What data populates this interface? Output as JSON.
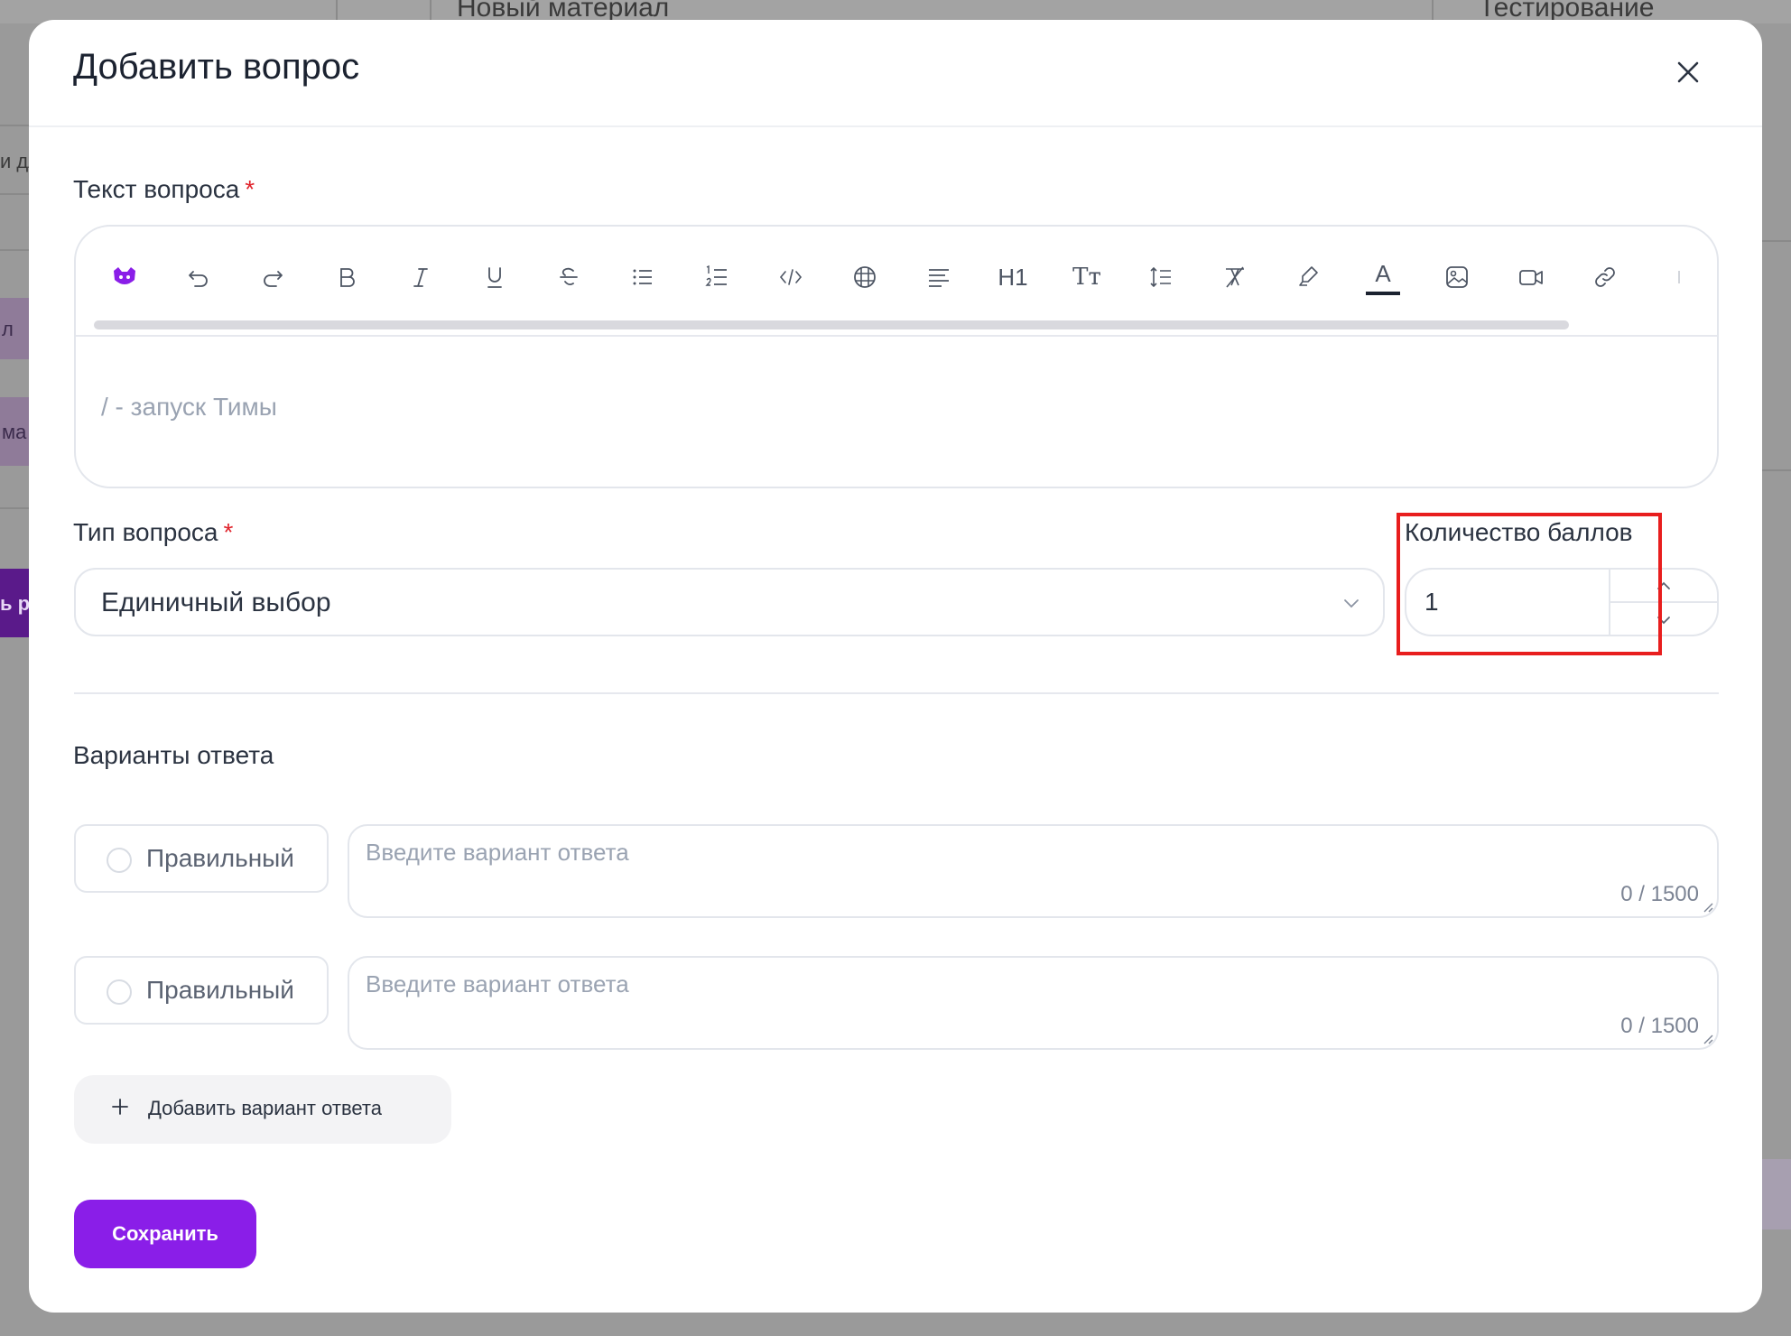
{
  "background": {
    "topbar_left_text": "Новый материал",
    "topbar_right_text": "Тестирование",
    "side_text_1": "и дл",
    "side_chip_1": "л",
    "side_chip_2": "ма",
    "side_chip_3": "ь р"
  },
  "modal": {
    "title": "Добавить вопрос",
    "close_icon": "close-icon"
  },
  "question_text": {
    "label": "Текст вопроса",
    "required_mark": "*",
    "placeholder": "/ - запуск Тимы",
    "toolbar": {
      "heading_label": "H1",
      "text_size_label": "Tт",
      "font_color_label": "A",
      "icons": [
        "tima-icon",
        "undo-icon",
        "redo-icon",
        "bold-icon",
        "italic-icon",
        "underline-icon",
        "strikethrough-icon",
        "bullet-list-icon",
        "numbered-list-icon",
        "code-icon",
        "table-icon",
        "align-icon",
        "heading-icon",
        "text-size-icon",
        "line-height-icon",
        "clear-format-icon",
        "highlighter-icon",
        "font-color-icon",
        "image-icon",
        "video-icon",
        "link-icon"
      ]
    }
  },
  "question_type": {
    "label": "Тип вопроса",
    "required_mark": "*",
    "value": "Единичный выбор"
  },
  "points": {
    "label": "Количество баллов",
    "value": "1"
  },
  "answers": {
    "section_title": "Варианты ответа",
    "items": [
      {
        "radio_label": "Правильный",
        "placeholder": "Введите вариант ответа",
        "counter": "0 / 1500"
      },
      {
        "radio_label": "Правильный",
        "placeholder": "Введите вариант ответа",
        "counter": "0 / 1500"
      }
    ],
    "add_label": "Добавить вариант ответа"
  },
  "actions": {
    "save_label": "Сохранить"
  },
  "colors": {
    "accent": "#8a1ee8",
    "required": "#e0242c",
    "highlight": "#e81e1e"
  }
}
